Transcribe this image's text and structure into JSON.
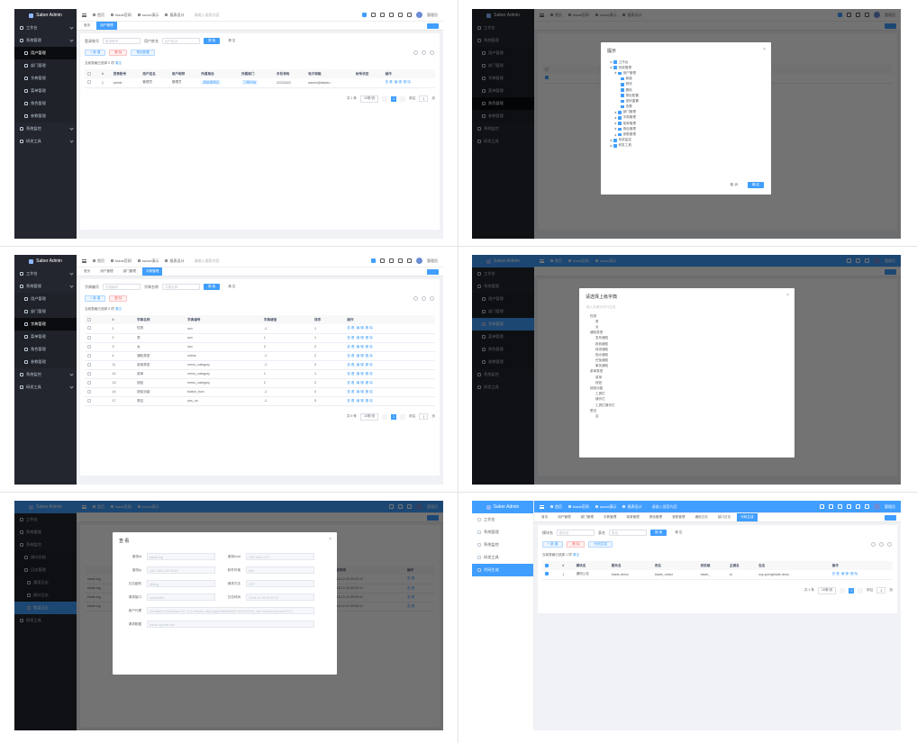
{
  "logo_text": "Saber Admin",
  "header": {
    "links": [
      "首页",
      "blade官网",
      "sword演示",
      "报表设计"
    ],
    "search_placeholder": "请输入搜索内容",
    "username": "管理员",
    "avatar_text": "Ad"
  },
  "sidebar_menu": {
    "workbench": "工作台",
    "system": "系统管理",
    "user": "用户管理",
    "dept": "部门管理",
    "dict": "字典管理",
    "menu": "菜单管理",
    "role": "角色管理",
    "params": "参数管理",
    "monitor": "系统监控",
    "dev": "研发工具",
    "api_doc": "接口文档",
    "log_usual": "通用日志",
    "log_api": "接口日志",
    "log_error": "错误日志",
    "log": "日志管理",
    "code": "代码生成"
  },
  "panel1": {
    "tags": [
      "首页",
      "用户管理"
    ],
    "search": {
      "account_label": "登录账号",
      "account_ph": "登录账号",
      "name_label": "用户姓名",
      "name_ph": "用户姓名",
      "search_btn": "搜 索",
      "clear_btn": "清 空"
    },
    "actions": {
      "add": "+ 新 增",
      "del": "删 除",
      "assign": "角色配置"
    },
    "notice_prefix": "当前表格已选择 0 项",
    "notice_link": "清空",
    "columns": [
      "#",
      "登录账号",
      "用户姓名",
      "用户昵称",
      "所属角色",
      "所属部门",
      "手机号码",
      "电子邮箱",
      "帐号状态",
      "操作"
    ],
    "rows": [
      {
        "idx": "1",
        "account": "admin",
        "name": "管理员",
        "nick": "管理员",
        "role": "超级管理员",
        "dept": "刀锋科技",
        "phone": "22233322",
        "email": "admin@bladex...",
        "status": ""
      }
    ],
    "row_ops": [
      "查 看",
      "编 辑",
      "删 除"
    ],
    "pager": {
      "total": "共 1 条",
      "size": "10条/页",
      "page": "1",
      "goto": "前往",
      "goto_val": "1",
      "page_unit": "页"
    }
  },
  "panel2": {
    "dialog_title": "提示",
    "tree": [
      "工作台",
      "系统管理",
      "用户管理",
      "新增",
      "修改",
      "删除",
      "角色配置",
      "密码重置",
      "查看",
      "部门管理",
      "字典管理",
      "菜单管理",
      "角色管理",
      "参数管理",
      "系统监控",
      "研发工具"
    ],
    "cancel": "取 消",
    "confirm": "确 定",
    "bg_row_name": "超级管理员",
    "bg_col": "角色名称"
  },
  "panel3": {
    "tags": [
      "首页",
      "用户管理",
      "部门管理",
      "字典管理"
    ],
    "search": {
      "code_label": "字典编号",
      "code_ph": "字典编号",
      "name_label": "字典名称",
      "name_ph": "字典名称",
      "search_btn": "搜 索",
      "clear_btn": "清 空"
    },
    "actions": {
      "add": "+ 新 增",
      "del": "删 除"
    },
    "notice_prefix": "当前表格已选择 0 项",
    "notice_link": "清空",
    "columns": [
      "#",
      "字典名称",
      "字典编号",
      "字典键值",
      "排序",
      "操作"
    ],
    "rows": [
      {
        "idx": "1",
        "name": "性别",
        "code": "sex",
        "key": "-1",
        "sort": "1"
      },
      {
        "idx": "2",
        "name": "男",
        "code": "sex",
        "key": "1",
        "sort": "1"
      },
      {
        "idx": "3",
        "name": "女",
        "code": "sex",
        "key": "2",
        "sort": "2"
      },
      {
        "idx": "4",
        "name": "通知类型",
        "code": "notice",
        "key": "-1",
        "sort": "2"
      },
      {
        "idx": "11",
        "name": "菜单类型",
        "code": "menu_category",
        "key": "-1",
        "sort": "3"
      },
      {
        "idx": "12",
        "name": "菜单",
        "code": "menu_category",
        "key": "1",
        "sort": "1"
      },
      {
        "idx": "13",
        "name": "按钮",
        "code": "menu_category",
        "key": "2",
        "sort": "2"
      },
      {
        "idx": "14",
        "name": "按钮功能",
        "code": "button_func",
        "key": "-1",
        "sort": "4"
      },
      {
        "idx": "17",
        "name": "是否",
        "code": "yes_no",
        "key": "-1",
        "sort": "5"
      }
    ],
    "row_ops": [
      "查 看",
      "编 辑",
      "删 除"
    ],
    "pager": {
      "total": "共 9 条",
      "size": "10条/页",
      "page": "1",
      "goto": "前往",
      "goto_val": "1",
      "page_unit": "页"
    }
  },
  "panel4": {
    "dialog_title": "请选择上级字典",
    "filter_ph": "输入关键字进行过滤",
    "tree": [
      "性别",
      "男",
      "女",
      "通知类型",
      "发布通知",
      "批转通知",
      "转发通知",
      "指示通知",
      "任免通知",
      "事务通知",
      "菜单类型",
      "菜单",
      "按钮",
      "按钮功能",
      "工具栏",
      "操作栏",
      "工具栏操作栏",
      "是否",
      "否"
    ]
  },
  "panel5": {
    "dialog_title": "查 看",
    "fields": [
      {
        "l1": "服务id",
        "v1": "blade-log",
        "l2": "服务host",
        "v2": "192.168.0.157"
      },
      {
        "l1": "服务ip",
        "v1": "192.168.0.157:8102",
        "l2": "软件环境",
        "v2": "dev"
      },
      {
        "l1": "日志级别",
        "v1": "debug",
        "l2": "请求方法",
        "v2": "GET"
      },
      {
        "l1": "请求接口",
        "v1": "/notice/list",
        "l2": "日志时间",
        "v2": "2018-12-29 09:53:12"
      }
    ],
    "ua_label": "用户代理",
    "ua_value": "Mozilla/5.0 (Windows NT 10.0; Win64; x64) AppleWebKit/537.36 (KHTML, like Gecko) Chrome/70.0",
    "data_label": "请求数据",
    "data_value": "blade log test info",
    "bg_col_time": "日志时间",
    "bg_col_op": "操作",
    "bg_rows": [
      {
        "svc": "blade-log",
        "ip": "192.168.0.157",
        "ipp": "192.168.0.157:8102",
        "env": "dev",
        "m": "GET",
        "url": "/log/list",
        "time": "2018-12-29 09:53:12"
      },
      {
        "svc": "blade-log",
        "ip": "192.168.0.157",
        "ipp": "192.168.0.157:8102",
        "env": "dev",
        "m": "GET",
        "url": "/log/list",
        "time": "2018-12-29 09:53:12"
      },
      {
        "svc": "blade-log",
        "ip": "192.168.0.157",
        "ipp": "192.168.0.157:8102",
        "env": "dev",
        "m": "GET",
        "url": "/log/list",
        "time": "2018-12-29 09:53:12"
      },
      {
        "svc": "blade-log",
        "ip": "192.168.0.157",
        "ipp": "192.168.0.157:8102",
        "env": "dev",
        "m": "GET",
        "url": "/log/list",
        "time": "2018-12-29 09:53:12"
      }
    ],
    "bg_op": "查 看"
  },
  "panel6": {
    "tags": [
      "首页",
      "用户管理",
      "部门管理",
      "字典管理",
      "菜单管理",
      "角色管理",
      "参数管理",
      "通用日志",
      "接口日志",
      "代码生成"
    ],
    "search": {
      "name_label": "模块名",
      "name_ph": "模块名",
      "table_label": "表名",
      "table_ph": "表名",
      "search_btn": "搜 索",
      "clear_btn": "清 空"
    },
    "actions": {
      "add": "+ 新 增",
      "del": "删 除",
      "gen": "代码生成"
    },
    "notice_prefix": "当前表格已选择 1 项",
    "notice_link": "清空",
    "columns": [
      "#",
      "模块名",
      "服务名",
      "表名",
      "表前缀",
      "主键名",
      "包名",
      "操作"
    ],
    "rows": [
      {
        "idx": "1",
        "mod": "通知公告",
        "svc": "blade-demo",
        "tbl": "blade_notice",
        "pre": "blade_",
        "pk": "id",
        "pkg": "org.springblade.desk..."
      }
    ],
    "row_ops": [
      "查 看",
      "编 辑",
      "删 除"
    ],
    "pager": {
      "total": "共 1 条",
      "size": "10条/页",
      "page": "1",
      "goto": "前往",
      "goto_val": "1",
      "page_unit": "页"
    }
  }
}
